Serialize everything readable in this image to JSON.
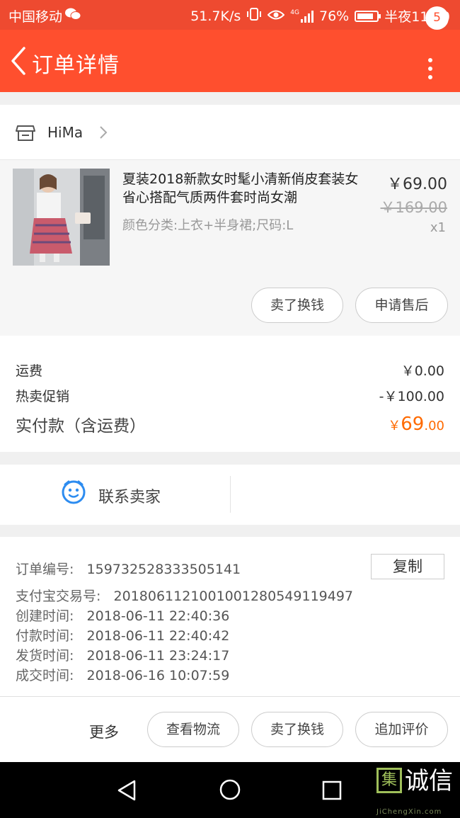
{
  "status_bar": {
    "carrier": "中国移动",
    "speed": "51.7K/s",
    "network": "4G",
    "battery": "76%",
    "time": "半夜11:20"
  },
  "header": {
    "title": "订单详情",
    "badge_count": "5"
  },
  "shop": {
    "name": "HiMa"
  },
  "product": {
    "name": "夏装2018新款女时髦小清新俏皮套装女省心搭配气质两件套时尚女潮",
    "spec": "颜色分类:上衣+半身裙;尺码:L",
    "price": "￥69.00",
    "original_price": "￥169.00",
    "quantity": "x1",
    "buttons": [
      "卖了换钱",
      "申请售后"
    ]
  },
  "fees": {
    "shipping_label": "运费",
    "shipping_value": "￥0.00",
    "promo_label": "热卖促销",
    "promo_value": "-￥100.00",
    "total_label": "实付款（含运费）",
    "total_currency": "￥",
    "total_int": "69",
    "total_dec": ".00"
  },
  "contact": {
    "label": "联系卖家"
  },
  "order_info": {
    "order_no_label": "订单编号:",
    "order_no": "159732528333505141",
    "copy_label": "复制",
    "alipay_label": "支付宝交易号:",
    "alipay_no": "2018061121001001280549119497",
    "created_label": "创建时间:",
    "created": "2018-06-11 22:40:36",
    "paid_label": "付款时间:",
    "paid": "2018-06-11 22:40:42",
    "shipped_label": "发货时间:",
    "shipped": "2018-06-11 23:24:17",
    "closed_label": "成交时间:",
    "closed": "2018-06-16 10:07:59"
  },
  "actions": {
    "more": "更多",
    "buttons": [
      "查看物流",
      "卖了换钱",
      "追加评价"
    ]
  },
  "watermark": {
    "box": "集",
    "text": "诚信",
    "sub": "JiChengXin.com"
  },
  "colors": {
    "accent": "#ff4f2e",
    "total": "#ff6a00",
    "icon_blue": "#2d8cf0"
  }
}
